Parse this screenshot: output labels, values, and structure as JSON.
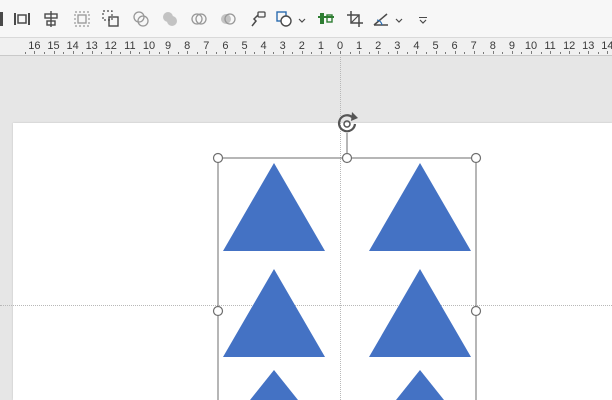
{
  "toolbar": {
    "buttons": [
      {
        "name": "distribute-horizontally-icon"
      },
      {
        "name": "distribute-vertically-icon"
      },
      {
        "name": "align-center-icon"
      },
      {
        "name": "group-icon"
      },
      {
        "name": "ungroup-icon"
      },
      {
        "name": "shape-union-icon"
      },
      {
        "name": "shape-combine-icon"
      },
      {
        "name": "shape-intersect-icon"
      },
      {
        "name": "shape-subtract-icon"
      },
      {
        "name": "format-painter-icon"
      },
      {
        "name": "shape-fill-icon"
      },
      {
        "name": "align-objects-icon"
      },
      {
        "name": "crop-icon"
      },
      {
        "name": "shape-outline-icon"
      },
      {
        "name": "more-options-icon"
      }
    ]
  },
  "ruler": {
    "labels": [
      "16",
      "15",
      "14",
      "13",
      "12",
      "11",
      "10",
      "9",
      "8",
      "7",
      "6",
      "5",
      "4",
      "3",
      "2",
      "1",
      "0",
      "1",
      "2",
      "3",
      "4",
      "5",
      "6",
      "7",
      "8",
      "9",
      "10",
      "11",
      "12",
      "13",
      "14"
    ]
  },
  "colors": {
    "triangle_fill": "#4472c4",
    "selection_stroke": "#6e6e6e",
    "toolbar_icon": "#4a4a4a",
    "toolbar_accent": "#2e7d32"
  }
}
